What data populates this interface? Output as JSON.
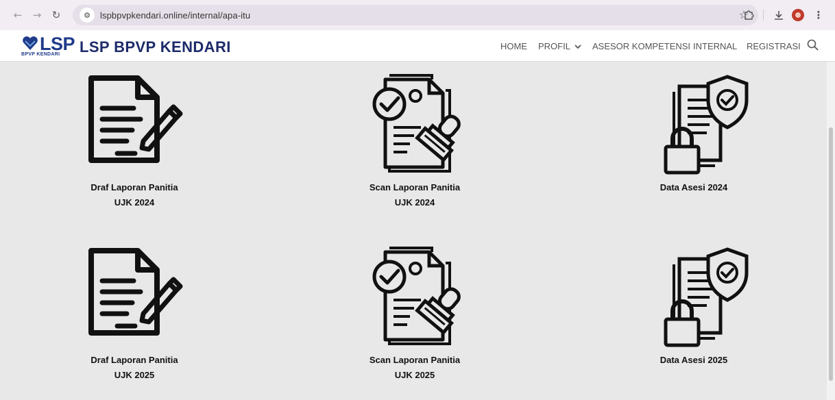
{
  "browser": {
    "url": "lspbpvpkendari.online/internal/apa-itu"
  },
  "site": {
    "logo_text": "LSP",
    "logo_subtext": "BPVP KENDARI",
    "title": "LSP BPVP KENDARI"
  },
  "nav": {
    "home": "HOME",
    "profil": "PROFIL",
    "asesor": "ASESOR KOMPETENSI",
    "internal": "INTERNAL",
    "registrasi": "REGISTRASI"
  },
  "cards": [
    {
      "line1": "Draf Laporan Panitia",
      "line2": "UJK 2024",
      "icon": "document-pen-icon"
    },
    {
      "line1": "Scan Laporan Panitia",
      "line2": "UJK 2024",
      "icon": "document-stamp-icon"
    },
    {
      "line1": "Data Asesi 2024",
      "line2": "",
      "icon": "document-lock-shield-icon"
    },
    {
      "line1": "Draf Laporan Panitia",
      "line2": "UJK 2025",
      "icon": "document-pen-icon"
    },
    {
      "line1": "Scan Laporan Panitia",
      "line2": "UJK 2025",
      "icon": "document-stamp-icon"
    },
    {
      "line1": "Data Asesi 2025",
      "line2": "",
      "icon": "document-lock-shield-icon"
    }
  ],
  "colors": {
    "brand": "#1e2b6a",
    "brand_accent": "#c0392b",
    "page_bg": "#e8e8e8"
  }
}
